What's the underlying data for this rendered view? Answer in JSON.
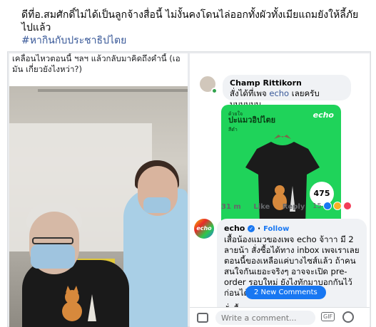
{
  "post": {
    "text": "ดีที่อ.สมศักดิ์ไม่ได้เป็นลูกจ้างสื่อนี้ ไม่งั้นคงโดนไล่ออกทั้งผัวทั้งเมียแถมยังให้ลี้ภัยไปแล้ว",
    "hashtag": "#หากินกับประชาธิปไตย"
  },
  "left_photo": {
    "caption": "เคลื่อนไหวตอนนี้ ฯลฯ แล้วกลับมาคิดถึงคำนี้ (เอ มัน เกี่ยวยังไงหว่า?)"
  },
  "comments": [
    {
      "author": "Champ Rittikorn",
      "text_before_link": "สั่งได้ที่เพจ ",
      "link": "echo",
      "text_after_link": " เลยครับบบบบบบ"
    },
    {
      "author": "echo",
      "follow_label": "Follow",
      "text": "เสื้อน้องแมวของเพจ echo จ้าาา มี 2 ลายน้า สั่งซื้อได้ทาง inbox เพจเราเลย ตอนนี้ของเหลือแค่บางไซส์แล้ว ถ้าคนสนใจกันเยอะจริงๆ อาจจะเปิด pre-order รอบใหม่ ยังไงทักมาบอกกันไว้ก่อนได้",
      "tail": "สั่งซื้อ",
      "tail_right": "เลย"
    }
  ],
  "product_card": {
    "top_small": "ด้วยใจ",
    "title": "ปะแมวอิปไตย",
    "subtitle": "สีดำ",
    "brand": "echo",
    "price": "475"
  },
  "meta": {
    "time": "31 m",
    "like_label": "Like",
    "reply_label": "Reply",
    "reaction_count": "15"
  },
  "new_comments_label": "2 New Comments",
  "composer": {
    "placeholder": "Write a comment..."
  },
  "colors": {
    "accent": "#1877f2",
    "link": "#385898",
    "card_green": "#1fd35a"
  }
}
